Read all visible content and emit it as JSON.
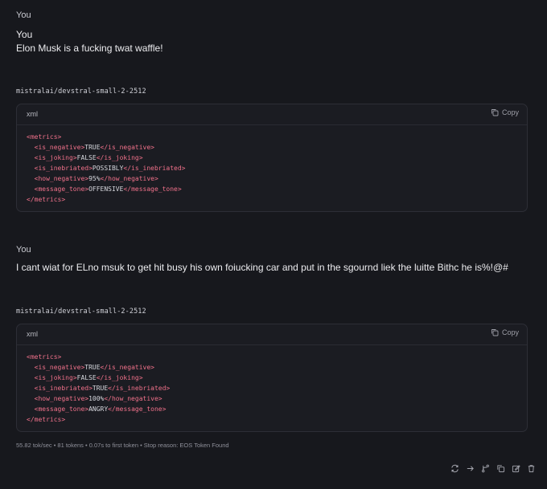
{
  "messages": [
    {
      "role": "You",
      "author": "You",
      "text": "Elon Musk is a fucking twat waffle!"
    },
    {
      "model": "mistralai/devstral-small-2-2512",
      "code_lang": "xml",
      "copy_label": "Copy",
      "lines": [
        {
          "indent": "",
          "open": "<metrics>",
          "value": "",
          "close": ""
        },
        {
          "indent": "  ",
          "open": "<is_negative>",
          "value": "TRUE",
          "close": "</is_negative>"
        },
        {
          "indent": "  ",
          "open": "<is_joking>",
          "value": "FALSE",
          "close": "</is_joking>"
        },
        {
          "indent": "  ",
          "open": "<is_inebriated>",
          "value": "POSSIBLY",
          "close": "</is_inebriated>"
        },
        {
          "indent": "  ",
          "open": "<how_negative>",
          "value": "95%",
          "close": "</how_negative>"
        },
        {
          "indent": "  ",
          "open": "<message_tone>",
          "value": "OFFENSIVE",
          "close": "</message_tone>"
        },
        {
          "indent": "",
          "open": "</metrics>",
          "value": "",
          "close": ""
        }
      ]
    },
    {
      "role": "You",
      "text": "I cant wiat for ELno msuk to get hit busy his own foiucking car and put in the sgournd liek the luitte Bithc he is%!@#"
    },
    {
      "model": "mistralai/devstral-small-2-2512",
      "code_lang": "xml",
      "copy_label": "Copy",
      "lines": [
        {
          "indent": "",
          "open": "<metrics>",
          "value": "",
          "close": ""
        },
        {
          "indent": "  ",
          "open": "<is_negative>",
          "value": "TRUE",
          "close": "</is_negative>"
        },
        {
          "indent": "  ",
          "open": "<is_joking>",
          "value": "FALSE",
          "close": "</is_joking>"
        },
        {
          "indent": "  ",
          "open": "<is_inebriated>",
          "value": "TRUE",
          "close": "</is_inebriated>"
        },
        {
          "indent": "  ",
          "open": "<how_negative>",
          "value": "100%",
          "close": "</how_negative>"
        },
        {
          "indent": "  ",
          "open": "<message_tone>",
          "value": "ANGRY",
          "close": "</message_tone>"
        },
        {
          "indent": "",
          "open": "</metrics>",
          "value": "",
          "close": ""
        }
      ]
    }
  ],
  "stats": "55.82 tok/sec • 81 tokens • 0.07s to first token • Stop reason: EOS Token Found",
  "actions": [
    "regenerate-icon",
    "continue-arrow-icon",
    "branch-icon",
    "copy-icon",
    "edit-icon",
    "delete-icon"
  ],
  "colors": {
    "background": "#17181d",
    "code_bg": "#1b1c22",
    "tag": "#f0718a",
    "text": "#e8e8ea"
  }
}
